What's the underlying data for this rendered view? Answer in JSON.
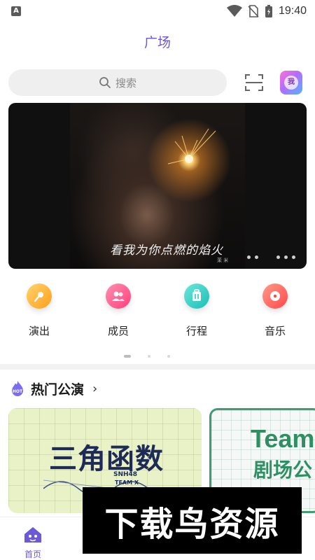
{
  "status_bar": {
    "time": "19:40",
    "app_badge": "A"
  },
  "header": {
    "title": "广场"
  },
  "search": {
    "placeholder": "搜索"
  },
  "avatar": {
    "text": "我"
  },
  "banner": {
    "caption": "看我为你点燃的焰火",
    "caption_small": "茉 米"
  },
  "categories": [
    {
      "label": "演出",
      "icon": "microphone-icon",
      "color": "#ffb13b"
    },
    {
      "label": "成员",
      "icon": "members-icon",
      "color": "#ff5f8f"
    },
    {
      "label": "行程",
      "icon": "luggage-icon",
      "color": "#36d3c8"
    },
    {
      "label": "音乐",
      "icon": "music-disc-icon",
      "color": "#ff6262"
    }
  ],
  "section": {
    "title": "热门公演"
  },
  "cards": [
    {
      "title": "三角函数",
      "subtitle": "SNH48",
      "team": "TEAM X"
    },
    {
      "title": "Team",
      "subtitle": "剧场公"
    }
  ],
  "bottom_nav": {
    "home_label": "首页"
  },
  "watermark": {
    "text": "下载鸟资源"
  },
  "colors": {
    "accent": "#6b59d6"
  }
}
